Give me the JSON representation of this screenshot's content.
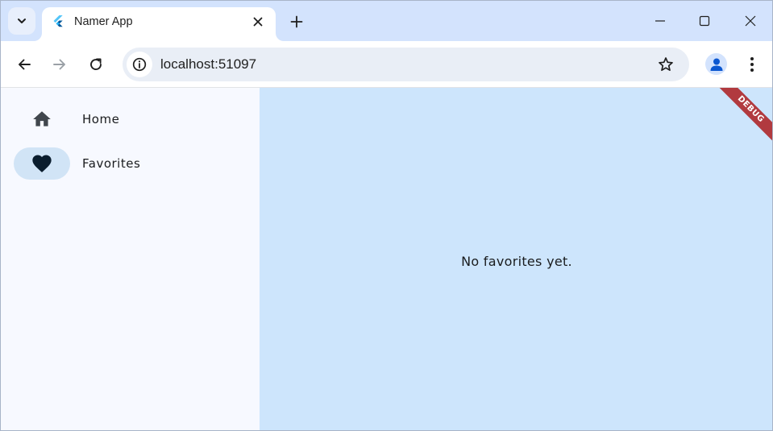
{
  "browser": {
    "tab": {
      "title": "Namer App",
      "favicon": "flutter-logo-icon"
    },
    "address_bar": {
      "url": "localhost:51097"
    },
    "icons": {
      "tab_search": "chevron-down-icon",
      "new_tab": "plus-icon",
      "minimize": "minimize-icon",
      "maximize": "maximize-icon",
      "close": "close-icon",
      "back": "back-arrow-icon",
      "forward": "forward-arrow-icon",
      "reload": "reload-icon",
      "site_info": "info-icon",
      "bookmark": "star-icon",
      "profile": "profile-icon",
      "menu": "more-vert-icon"
    }
  },
  "app": {
    "navigation": {
      "items": [
        {
          "label": "Home",
          "icon": "home-icon",
          "selected": false
        },
        {
          "label": "Favorites",
          "icon": "heart-icon",
          "selected": true
        }
      ]
    },
    "main": {
      "empty_message": "No favorites yet."
    },
    "debug_banner": "DEBUG",
    "colors": {
      "rail_background": "#f7f9ff",
      "main_background": "#cde5fc",
      "selected_indicator": "#d1e4f6",
      "debug_banner": "#b13a3f",
      "tabstrip": "#d3e3fd"
    }
  }
}
